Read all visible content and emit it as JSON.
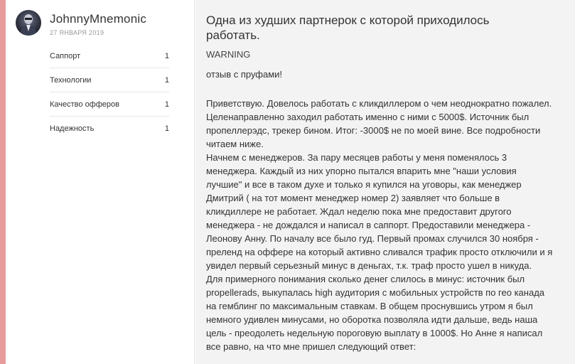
{
  "author": {
    "name": "JohnnyMnemonic",
    "date": "27 ЯНВАРЯ 2019"
  },
  "ratings": [
    {
      "label": "Саппорт",
      "value": "1"
    },
    {
      "label": "Технологии",
      "value": "1"
    },
    {
      "label": "Качество офферов",
      "value": "1"
    },
    {
      "label": "Надежность",
      "value": "1"
    }
  ],
  "post": {
    "title": "Одна из худших партнерок с которой приходилось работать.",
    "warning": "WARNING",
    "subtitle": "отзыв с пруфами!",
    "paragraphs": [
      "Приветствую. Довелось работать с кликдиллером о чем неоднократно пожалел.",
      "Целенаправленно заходил работать именно с ними с 5000$. Источник был пропеллерэдс, трекер бином. Итог: -3000$ не по моей вине. Все подробности читаем ниже.",
      "Начнем с менеджеров. За пару месяцев работы у меня поменялось 3 менеджера. Каждый из них упорно пытался впарить мне \"наши условия лучшие\" и все в таком духе и только я купился на уговоры, как менеджер Дмитрий ( на тот момент менеджер номер 2) заявляет что больше в кликдиллере не работает. Ждал неделю пока мне предоставит другого менеджера - не дождался и написал в саппорт. Предоставили менеджера - Леонову Анну. По началу все было гуд. Первый промах случился 30 ноября - преленд на оффере на который активно сливался трафик просто отключили и я увидел первый серьезный минус в деньгах, т.к. траф просто ушел в никуда.",
      "Для примерного понимания сколько денег слилось в минус: источник был propellerads, выкупалась high аудитория с мобильных устройств по гео канада на гемблинг по максимальным ставкам. В общем проснувшись утром я был немного удивлен минусами, но оборотка позволяла идти дальше, ведь наша цель - преодолеть недельную пороговую выплату в 1000$. Но Анне я написал все равно, на что мне пришел следующий ответ:"
    ]
  },
  "colors": {
    "accent_bar": "#e89b9b",
    "content_bg": "#f3f3f3"
  }
}
